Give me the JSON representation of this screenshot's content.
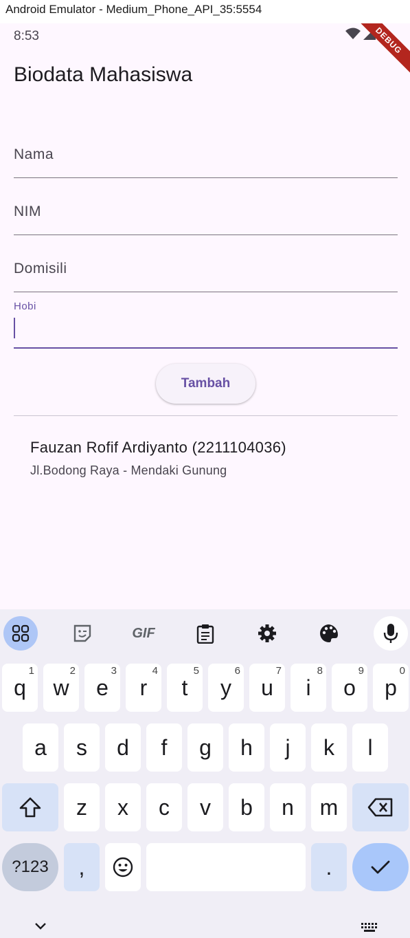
{
  "window": {
    "title": "Android Emulator - Medium_Phone_API_35:5554"
  },
  "status_bar": {
    "time": "8:53",
    "debug_banner": "DEBUG"
  },
  "app": {
    "title": "Biodata Mahasiswa",
    "fields": [
      {
        "label": "Nama",
        "value": ""
      },
      {
        "label": "NIM",
        "value": ""
      },
      {
        "label": "Domisili",
        "value": ""
      },
      {
        "label": "Hobi",
        "value": ""
      }
    ],
    "add_button": "Tambah",
    "list": [
      {
        "title": "Fauzan Rofif Ardiyanto (2211104036)",
        "subtitle": "Jl.Bodong Raya - Mendaki Gunung"
      }
    ]
  },
  "keyboard": {
    "toolbar": [
      "apps-grid-icon",
      "sticker-icon",
      "gif-icon",
      "clipboard-icon",
      "settings-icon",
      "palette-icon",
      "mic-icon"
    ],
    "gif_label": "GIF",
    "row1": [
      "q",
      "w",
      "e",
      "r",
      "t",
      "y",
      "u",
      "i",
      "o",
      "p"
    ],
    "row1_hints": [
      "1",
      "2",
      "3",
      "4",
      "5",
      "6",
      "7",
      "8",
      "9",
      "0"
    ],
    "row2": [
      "a",
      "s",
      "d",
      "f",
      "g",
      "h",
      "j",
      "k",
      "l"
    ],
    "row3": [
      "z",
      "x",
      "c",
      "v",
      "b",
      "n",
      "m"
    ],
    "symbols_key": "?123",
    "comma_key": ",",
    "period_key": "."
  }
}
